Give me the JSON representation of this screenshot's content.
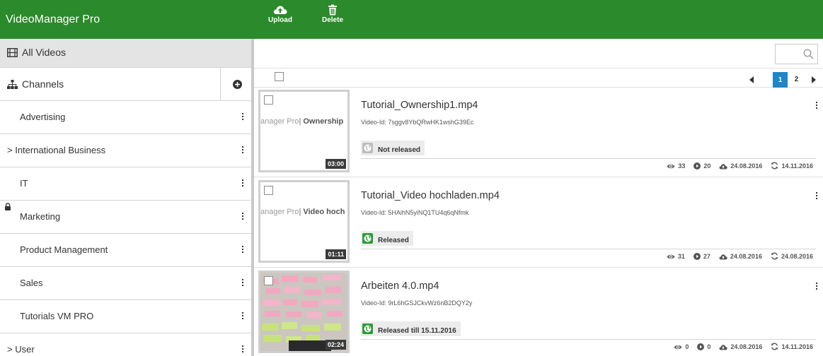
{
  "app": {
    "title": "VideoManager Pro"
  },
  "toolbar": {
    "upload_label": "Upload",
    "delete_label": "Delete"
  },
  "sidebar": {
    "all_videos": "All Videos",
    "channels_title": "Channels",
    "items": [
      {
        "label": "Advertising",
        "expandable": false,
        "locked": false
      },
      {
        "label": "> International Business",
        "expandable": true,
        "locked": false
      },
      {
        "label": "IT",
        "expandable": false,
        "locked": false
      },
      {
        "label": "Marketing",
        "expandable": false,
        "locked": true
      },
      {
        "label": "Product Management",
        "expandable": false,
        "locked": false
      },
      {
        "label": "Sales",
        "expandable": false,
        "locked": false
      },
      {
        "label": "Tutorials VM PRO",
        "expandable": false,
        "locked": false
      },
      {
        "label": "> User",
        "expandable": true,
        "locked": false
      }
    ]
  },
  "search": {
    "placeholder": ""
  },
  "pagination": {
    "pages": [
      "1",
      "2"
    ],
    "current": "1"
  },
  "videos": [
    {
      "thumb_text_left": "anager Pro",
      "thumb_text_right": "Ownership",
      "duration": "03:00",
      "title": "Tutorial_Ownership1.mp4",
      "video_id": "Video-Id: 7sggv8YbQRwHK1wshG39Ec",
      "status": "Not released",
      "released": false,
      "views": "33",
      "plays": "20",
      "uploaded": "24.08.2016",
      "updated": "14.11.2016"
    },
    {
      "thumb_text_left": "anager Pro",
      "thumb_text_right": "Video hoch",
      "duration": "01:11",
      "title": "Tutorial_Video hochladen.mp4",
      "video_id": "Video-Id: 5HAihN5yiNQ1TU4q6qNfmk",
      "status": "Released",
      "released": true,
      "views": "31",
      "plays": "27",
      "uploaded": "24.08.2016",
      "updated": "24.08.2016"
    },
    {
      "thumb_text_left": "",
      "thumb_text_right": "",
      "duration": "02:24",
      "title": "Arbeiten 4.0.mp4",
      "video_id": "Video-Id: 9rL6hGSJCkvWz6nB2DQY2y",
      "status": "Released till 15.11.2016",
      "released": true,
      "views": "0",
      "plays": "0",
      "uploaded": "24.08.2016",
      "updated": "14.11.2016"
    }
  ],
  "colors": {
    "brand_green": "#2b8a2b",
    "pager_active": "#1f86c7",
    "released_green": "#2f9a3a",
    "not_released_gray": "#bdbdbd"
  }
}
